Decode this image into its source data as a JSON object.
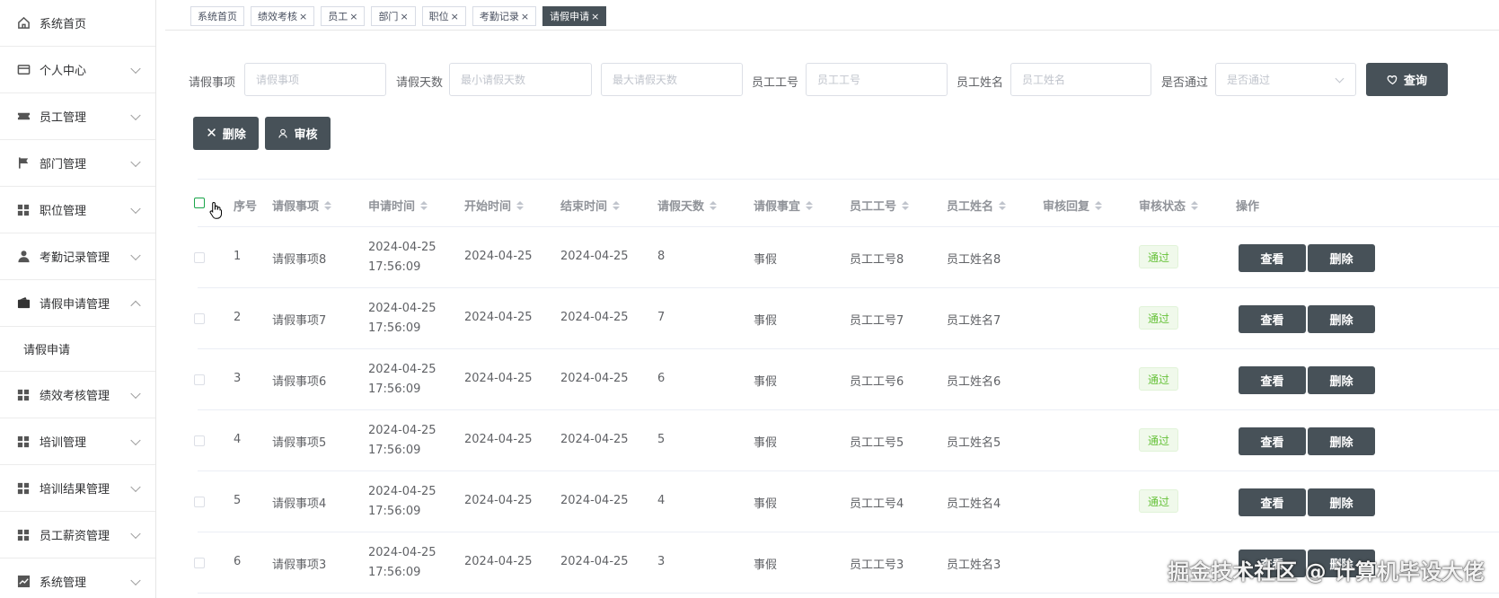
{
  "sidebar": {
    "items": [
      {
        "label": "系统首页",
        "icon": "home-icon",
        "arrow": false
      },
      {
        "label": "个人中心",
        "icon": "card-icon",
        "arrow": true
      },
      {
        "label": "员工管理",
        "icon": "ticket-icon",
        "arrow": true
      },
      {
        "label": "部门管理",
        "icon": "flag-icon",
        "arrow": true
      },
      {
        "label": "职位管理",
        "icon": "grid-icon",
        "arrow": true
      },
      {
        "label": "考勤记录管理",
        "icon": "user-icon",
        "arrow": true
      },
      {
        "label": "请假申请管理",
        "icon": "wallet-icon",
        "arrow": true,
        "expanded": true
      },
      {
        "label": "请假申请",
        "sub": true
      },
      {
        "label": "绩效考核管理",
        "icon": "grid-icon",
        "arrow": true
      },
      {
        "label": "培训管理",
        "icon": "grid-icon",
        "arrow": true
      },
      {
        "label": "培训结果管理",
        "icon": "grid-icon",
        "arrow": true
      },
      {
        "label": "员工薪资管理",
        "icon": "grid-icon",
        "arrow": true
      },
      {
        "label": "系统管理",
        "icon": "chart-icon",
        "arrow": true
      }
    ]
  },
  "tabs": [
    {
      "label": "系统首页",
      "closable": false,
      "active": false
    },
    {
      "label": "绩效考核",
      "closable": true,
      "active": false
    },
    {
      "label": "员工",
      "closable": true,
      "active": false
    },
    {
      "label": "部门",
      "closable": true,
      "active": false
    },
    {
      "label": "职位",
      "closable": true,
      "active": false
    },
    {
      "label": "考勤记录",
      "closable": true,
      "active": false
    },
    {
      "label": "请假申请",
      "closable": true,
      "active": true
    }
  ],
  "search": {
    "leave_item_label": "请假事项",
    "leave_item_placeholder": "请假事项",
    "days_label": "请假天数",
    "min_days_placeholder": "最小请假天数",
    "max_days_placeholder": "最大请假天数",
    "emp_no_label": "员工工号",
    "emp_no_placeholder": "员工工号",
    "emp_name_label": "员工姓名",
    "emp_name_placeholder": "员工姓名",
    "approved_label": "是否通过",
    "approved_placeholder": "是否通过",
    "query_button": "查询"
  },
  "actions": {
    "delete_button": "删除",
    "review_button": "审核"
  },
  "table": {
    "headers": {
      "index": "序号",
      "leave_item": "请假事项",
      "apply_time": "申请时间",
      "start_time": "开始时间",
      "end_time": "结束时间",
      "days": "请假天数",
      "reason": "请假事宜",
      "emp_no": "员工工号",
      "emp_name": "员工姓名",
      "reply": "审核回复",
      "status": "审核状态",
      "ops": "操作"
    },
    "view_label": "查看",
    "delete_label": "删除",
    "rows": [
      {
        "index": "1",
        "leave_item": "请假事项8",
        "apply_time": "2024-04-25 17:56:09",
        "start_time": "2024-04-25",
        "end_time": "2024-04-25",
        "days": "8",
        "reason": "事假",
        "emp_no": "员工工号8",
        "emp_name": "员工姓名8",
        "reply": "",
        "status": "通过"
      },
      {
        "index": "2",
        "leave_item": "请假事项7",
        "apply_time": "2024-04-25 17:56:09",
        "start_time": "2024-04-25",
        "end_time": "2024-04-25",
        "days": "7",
        "reason": "事假",
        "emp_no": "员工工号7",
        "emp_name": "员工姓名7",
        "reply": "",
        "status": "通过"
      },
      {
        "index": "3",
        "leave_item": "请假事项6",
        "apply_time": "2024-04-25 17:56:09",
        "start_time": "2024-04-25",
        "end_time": "2024-04-25",
        "days": "6",
        "reason": "事假",
        "emp_no": "员工工号6",
        "emp_name": "员工姓名6",
        "reply": "",
        "status": "通过"
      },
      {
        "index": "4",
        "leave_item": "请假事项5",
        "apply_time": "2024-04-25 17:56:09",
        "start_time": "2024-04-25",
        "end_time": "2024-04-25",
        "days": "5",
        "reason": "事假",
        "emp_no": "员工工号5",
        "emp_name": "员工姓名5",
        "reply": "",
        "status": "通过"
      },
      {
        "index": "5",
        "leave_item": "请假事项4",
        "apply_time": "2024-04-25 17:56:09",
        "start_time": "2024-04-25",
        "end_time": "2024-04-25",
        "days": "4",
        "reason": "事假",
        "emp_no": "员工工号4",
        "emp_name": "员工姓名4",
        "reply": "",
        "status": "通过"
      },
      {
        "index": "6",
        "leave_item": "请假事项3",
        "apply_time": "2024-04-25 17:56:09",
        "start_time": "2024-04-25",
        "end_time": "2024-04-25",
        "days": "3",
        "reason": "事假",
        "emp_no": "员工工号3",
        "emp_name": "员工姓名3",
        "reply": "",
        "status": ""
      }
    ]
  },
  "watermark": "掘金技术社区 @ 计算机毕设大佬",
  "colors": {
    "accent": "#475158",
    "success": "#67c23a"
  }
}
